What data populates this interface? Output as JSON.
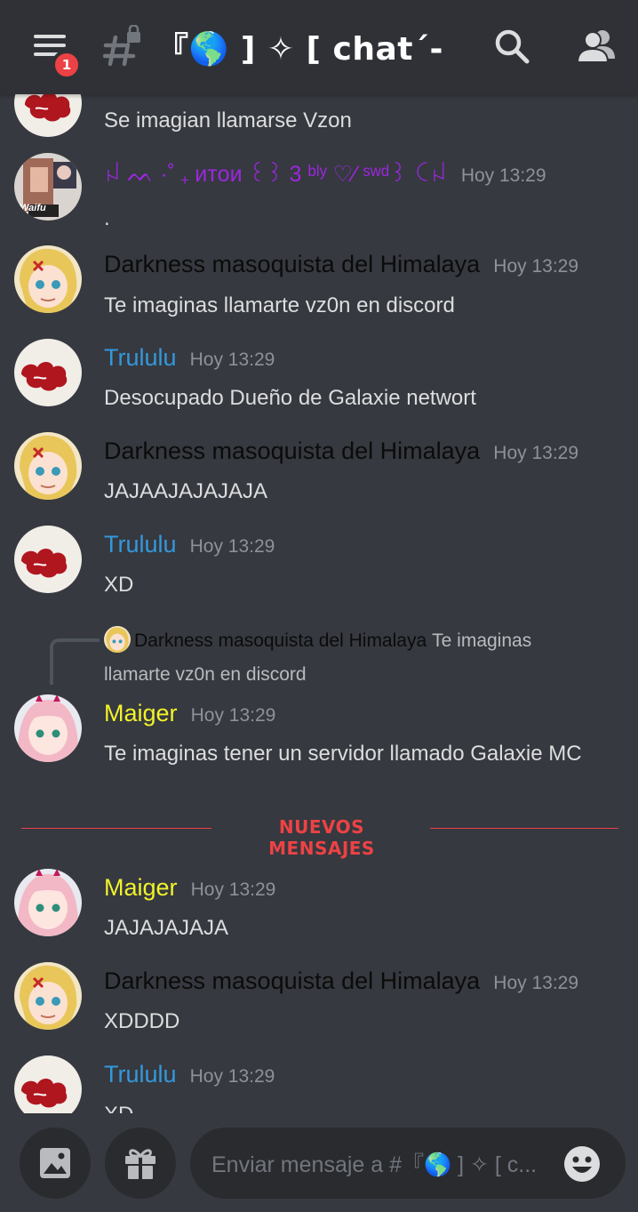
{
  "header": {
    "notification_count": "1",
    "channel_title": "『🌎 ] ✧ [ chat´-"
  },
  "icons": {
    "menu": "hamburger-icon",
    "channel": "locked-text-channel-icon",
    "search": "search-icon",
    "members": "members-icon",
    "image": "image-icon",
    "gift": "gift-icon",
    "emoji": "emoji-icon"
  },
  "colors": {
    "background": "#36393f",
    "header": "#2f3136",
    "mention_red": "#ed4245",
    "trululu": "#3498db",
    "maiger": "#f1f22b",
    "purple_user": "#9b27e0"
  },
  "messages": [
    {
      "author": "",
      "time": "",
      "text": "Se imagian llamarse Vzon"
    },
    {
      "author": "ꈤ ᨓ ·˚ ₊ ᴎᴛᴏᴎ ꒰꒱ 3 ᵇˡʸ ♡⁄ ˢʷᵈ꒱ ꉔꈤ",
      "time": "Hoy 13:29",
      "text": ".",
      "avatar_label": "Waifu"
    },
    {
      "author": "Darkness masoquista del Himalaya",
      "time": "Hoy 13:29",
      "text": "Te imaginas llamarte vz0n en discord"
    },
    {
      "author": "Trululu",
      "time": "Hoy 13:29",
      "text": "Desocupado Dueño de Galaxie networt"
    },
    {
      "author": "Darkness masoquista del Himalaya",
      "time": "Hoy 13:29",
      "text": "JAJAAJAJAJAJA"
    },
    {
      "author": "Trululu",
      "time": "Hoy 13:29",
      "text": "XD"
    },
    {
      "author": "Maiger",
      "time": "Hoy 13:29",
      "text": "Te imaginas tener un servidor llamado Galaxie MC"
    },
    {
      "author": "Maiger",
      "time": "Hoy 13:29",
      "text": "JAJAJAJAJA"
    },
    {
      "author": "Darkness masoquista del Himalaya",
      "time": "Hoy 13:29",
      "text": "XDDDD"
    },
    {
      "author": "Trululu",
      "time": "Hoy 13:29",
      "text": "XD"
    }
  ],
  "reply": {
    "author": "Darkness masoquista del Himalaya",
    "text_line1": "Te imaginas",
    "text_line2": "llamarte vz0n en discord"
  },
  "divider": {
    "label": "NUEVOS MENSAJES"
  },
  "composer": {
    "placeholder": "Enviar mensaje a #『🌎 ] ✧ [ c..."
  }
}
